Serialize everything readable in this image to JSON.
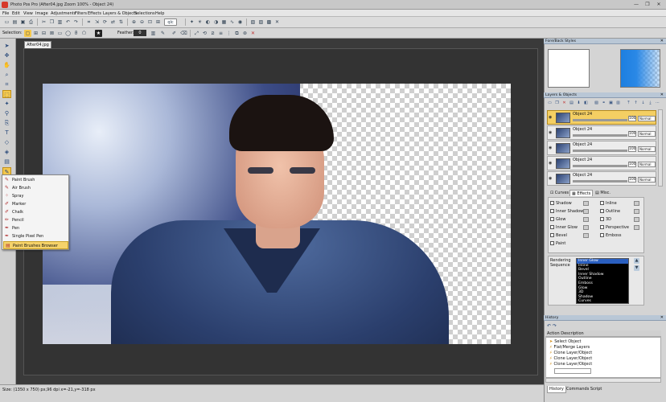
{
  "window": {
    "title": "Photo Pos Pro (After04.jpg Zoom 100% - Object 24)",
    "controls": [
      "—",
      "❐",
      "✕"
    ]
  },
  "menu": [
    "File",
    "Edit",
    "View",
    "Image",
    "Adjustments",
    "Filters",
    "Effects",
    "Layers & Objects",
    "Selections",
    "Help"
  ],
  "toolbar": {
    "selection_label": "Selection:",
    "feather_label": "Feather:",
    "feather_value": "0",
    "zoom_mode": "qlc"
  },
  "document": {
    "tab_label": "After04.jpg"
  },
  "brush_menu": {
    "items": [
      "Paint Brush",
      "Air Brush",
      "Spray",
      "Marker",
      "Chalk",
      "Pencil",
      "Pen",
      "Single Pixel Pen",
      "Paint Brushes Browser"
    ],
    "highlighted_index": 8
  },
  "panels": {
    "fill_back_styles": "Fore/Back Styles",
    "layers_objects": "Layers & Objects",
    "history": "History"
  },
  "layers": [
    {
      "name": "Object 24",
      "opacity": "100",
      "mode": "Normal",
      "selected": true
    },
    {
      "name": "Object 24",
      "opacity": "100",
      "mode": "Normal",
      "selected": false
    },
    {
      "name": "Object 24",
      "opacity": "100",
      "mode": "Normal",
      "selected": false
    },
    {
      "name": "Object 24",
      "opacity": "100",
      "mode": "Normal",
      "selected": false
    },
    {
      "name": "Object 24",
      "opacity": "100",
      "mode": "Normal",
      "selected": false
    }
  ],
  "prop_tabs": [
    "Curves",
    "Effects",
    "Misc."
  ],
  "effects_left": [
    "Shadow",
    "Inner Shadow",
    "Glow",
    "Inner Glow",
    "Bevel",
    "Paint"
  ],
  "effects_right": [
    "Inline",
    "Outline",
    "3D",
    "Perspective",
    "Emboss"
  ],
  "rendering": {
    "label": "Rendering Sequence",
    "items": [
      "Inner Glow",
      "Inline",
      "Bevel",
      "Inner Shadow",
      "Outline",
      "Emboss",
      "Glow",
      "3D",
      "Shadow",
      "Curves"
    ]
  },
  "history": {
    "header": "Action Description",
    "items": [
      "Select Object",
      "Flat/Merge Layers",
      "Clone Layer/Object",
      "Clone Layer/Object",
      "Clone Layer/Object"
    ]
  },
  "bottom_tabs": [
    "History",
    "Commands Script"
  ],
  "status": {
    "text": "Size: (1350 x 750) px,96 dpi   x=-21,y=-318 px"
  }
}
